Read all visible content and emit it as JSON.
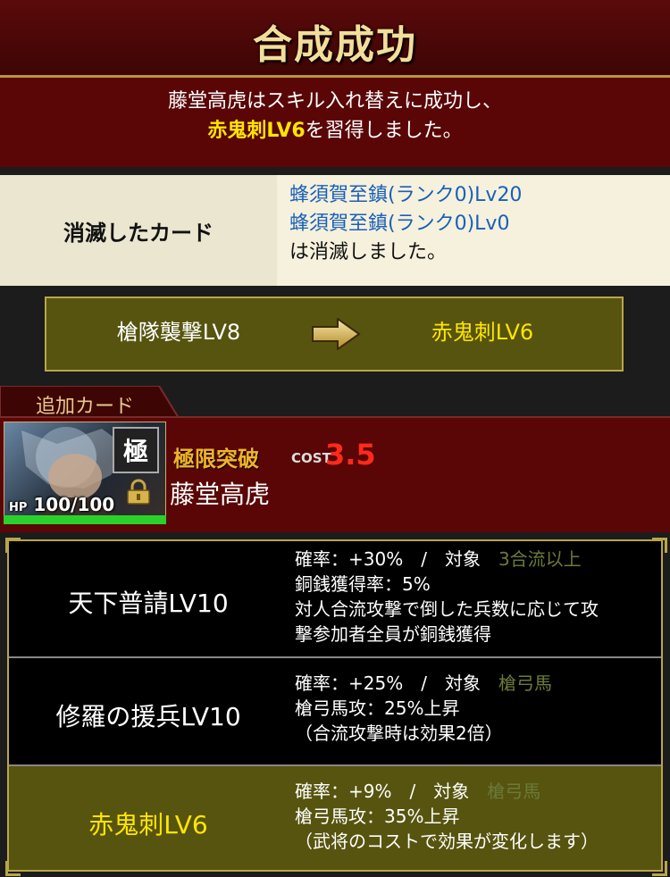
{
  "header": {
    "title": "合成成功"
  },
  "message": {
    "line1": "藤堂高虎はスキル入れ替えに成功し、",
    "skill": "赤鬼刺LV6",
    "line2_suffix": "を習得しました。"
  },
  "consumed": {
    "label": "消滅したカード",
    "cards": [
      "蜂須賀至鎮(ランク0)Lv20",
      "蜂須賀至鎮(ランク0)Lv0"
    ],
    "suffix": "は消滅しました。"
  },
  "transfer": {
    "from": "槍隊襲撃LV8",
    "to": "赤鬼刺LV6",
    "arrow_icon": "right-arrow-icon"
  },
  "added_card": {
    "tab_label": "追加カード",
    "rank_badge": "極",
    "hp_label": "HP",
    "hp_value": "100/100",
    "hp_percent": 100,
    "status": "極限突破",
    "cost_label": "COST",
    "cost_value": "3.5",
    "name": "藤堂高虎"
  },
  "skills": [
    {
      "name": "天下普請LV10",
      "rate_line": "確率：+30%　/　対象",
      "target": "3合流以上",
      "lines": [
        "銅銭獲得率：5%",
        "対人合流攻撃で倒した兵数に応じて攻",
        "撃参加者全員が銅銭獲得"
      ]
    },
    {
      "name": "修羅の援兵LV10",
      "rate_line": "確率：+25%　/　対象",
      "target": "槍弓馬",
      "lines": [
        "槍弓馬攻：25%上昇",
        "（合流攻撃時は効果2倍）"
      ]
    },
    {
      "name": "赤鬼刺LV6",
      "rate_line": "確率：+9%　/　対象",
      "target": "槍弓馬",
      "lines": [
        "槍弓馬攻：35%上昇",
        "（武将のコストで効果が変化します）"
      ]
    }
  ]
}
